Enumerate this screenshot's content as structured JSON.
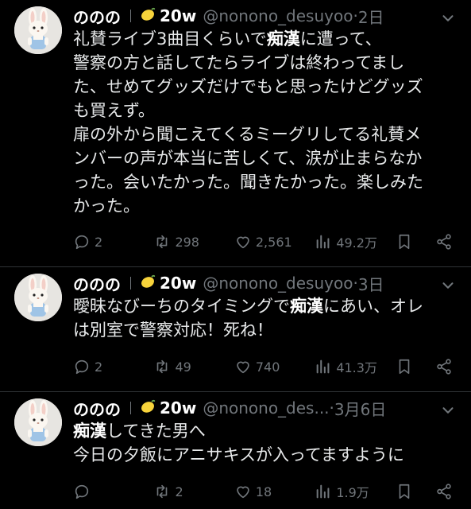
{
  "tweets": [
    {
      "name": "ののの",
      "badge": "20w",
      "handle": "@nonono_desuyoo",
      "dot": "·",
      "time": "2日",
      "text_a": "礼賛ライブ3曲目くらいで",
      "keyword": "痴漢",
      "text_b": "に遭って、\n警察の方と話してたらライブは終わってまし\nた、せめてグッズだけでもと思ったけどグッズ\nも買えず。\n扉の外から聞こえてくるミーグリしてる礼賛メ\nンバーの声が本当に苦しくて、涙が止まらなか\nった。会いたかった。聞きたかった。楽しみた\nかった。",
      "replies": "2",
      "retweets": "298",
      "likes": "2,561",
      "views": "49.2万"
    },
    {
      "name": "ののの",
      "badge": "20w",
      "handle": "@nonono_desuyoo",
      "dot": "·",
      "time": "3日",
      "text_a": "曖昧なびーちのタイミングで",
      "keyword": "痴漢",
      "text_b": "にあい、オレ\nは別室で警察対応！死ね！",
      "replies": "2",
      "retweets": "49",
      "likes": "740",
      "views": "41.3万"
    },
    {
      "name": "ののの",
      "badge": "20w",
      "handle": "@nonono_des...",
      "dot": "·",
      "time": "3月6日",
      "text_a": "",
      "keyword": "痴漢",
      "text_b": "してきた男へ\n今日の夕飯にアニサキスが入ってますように",
      "replies": "",
      "retweets": "2",
      "likes": "18",
      "views": "1.9万"
    }
  ]
}
